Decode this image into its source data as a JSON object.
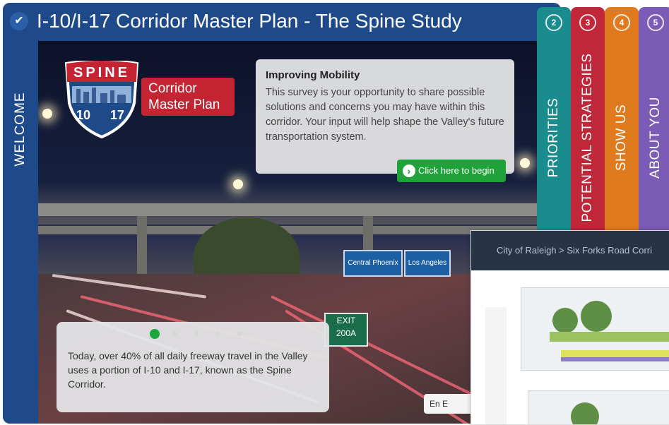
{
  "header": {
    "title": "I-10/I-17 Corridor Master Plan - The Spine Study",
    "check_glyph": "✔"
  },
  "left_rail": {
    "welcome_label": "WELCOME",
    "help_glyph": "?"
  },
  "logo": {
    "spine": "SPINE",
    "route_a": "10",
    "route_b": "17",
    "plan_line1": "Corridor",
    "plan_line2": "Master Plan"
  },
  "info_card": {
    "heading": "Improving Mobility",
    "body": "This survey is your opportunity to share possible solutions and concerns you may have within this corridor. Your input will help shape the Valley's future transportation system.",
    "button_label": "Click here to begin"
  },
  "carousel": {
    "count": 5,
    "active": 0
  },
  "caption": "Today, over 40% of all daily freeway travel in the Valley uses a portion of I-10 and I-17, known as the Spine Corridor.",
  "signs": {
    "sign1": "Central Phoenix",
    "sign2": "Los Angeles",
    "exit": "EXIT",
    "exit_num": "200A"
  },
  "language_button": "En E",
  "steps": [
    {
      "num": "2",
      "label": "PRIORITIES",
      "color": "#1a8c8e"
    },
    {
      "num": "3",
      "label": "POTENTIAL STRATEGIES",
      "color": "#c0283a"
    },
    {
      "num": "4",
      "label": "SHOW US",
      "color": "#e07a1f"
    },
    {
      "num": "5",
      "label": "ABOUT YOU",
      "color": "#7a5bb5"
    }
  ],
  "overlay": {
    "breadcrumb": "City of Raleigh > Six Forks Road Corri"
  },
  "colors": {
    "frame": "#1f4a8a",
    "button_green": "#1fa23a",
    "logo_red": "#c52432"
  }
}
